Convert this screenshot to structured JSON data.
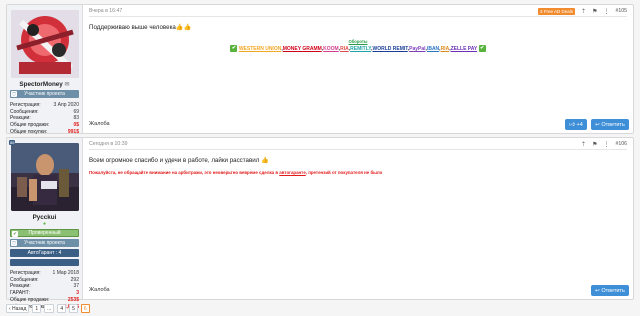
{
  "post1": {
    "avatar_alt": "",
    "username": "SpectorMoney",
    "badge": "Участник проекта",
    "stats": [
      {
        "label": "Регистрация:",
        "value": "3 Апр 2020",
        "red": false
      },
      {
        "label": "Сообщения:",
        "value": "69",
        "red": false
      },
      {
        "label": "Реакции:",
        "value": "83",
        "red": false
      },
      {
        "label": "Общие продажи:",
        "value": "0$",
        "red": true
      },
      {
        "label": "Общие покупки:",
        "value": "991$",
        "red": true
      }
    ],
    "date": "Вчера в 16:47",
    "tag": "3 Free AD Deals",
    "number": "#105",
    "message": "Поддерживаю выше человека",
    "sig_title": "Обороты",
    "sig_items": [
      {
        "text": "WESTERN UNION",
        "cls": "s-wu"
      },
      {
        "text": ",",
        "cls": ""
      },
      {
        "text": "MONEY GRAMM",
        "cls": "s-mg"
      },
      {
        "text": ",",
        "cls": ""
      },
      {
        "text": "KOOM",
        "cls": "s-ko"
      },
      {
        "text": ",",
        "cls": ""
      },
      {
        "text": "RIA",
        "cls": "s-ra"
      },
      {
        "text": ",",
        "cls": ""
      },
      {
        "text": "REMITLY",
        "cls": "s-rem"
      },
      {
        "text": ",",
        "cls": ""
      },
      {
        "text": "WORLD REMIT",
        "cls": "s-wr"
      },
      {
        "text": ",",
        "cls": ""
      },
      {
        "text": "PayPal",
        "cls": "s-pp"
      },
      {
        "text": ",",
        "cls": ""
      },
      {
        "text": "IBAN",
        "cls": "s-iban"
      },
      {
        "text": ",",
        "cls": ""
      },
      {
        "text": "RIA",
        "cls": "s-ria"
      },
      {
        "text": ",",
        "cls": ""
      },
      {
        "text": "ZELLE PAY",
        "cls": "s-zelle"
      }
    ],
    "complaint": "Жалоба",
    "like_count": "4",
    "reply": "Ответить"
  },
  "post2": {
    "rank": "86",
    "username": "Pycckui",
    "badges": [
      "Проверенный",
      "Участник проекта",
      "АвтоГарант : 4"
    ],
    "stats": [
      {
        "label": "Регистрация:",
        "value": "1 Мар 2018",
        "red": false
      },
      {
        "label": "Сообщения:",
        "value": "292",
        "red": false
      },
      {
        "label": "Реакции:",
        "value": "37",
        "red": false
      },
      {
        "label": "ГАРАНТ:",
        "value": "3",
        "red": true
      },
      {
        "label": "Общие продажи:",
        "value": "253$",
        "red": true
      },
      {
        "label": "Общие покупки:",
        "value": "2,606$",
        "red": true
      }
    ],
    "date": "Сегодня в 10:39",
    "number": "#106",
    "message": "Всем огромное спасибо и удечи в работе, лайки расставил",
    "warn_pre": "Пожалуйста, не обращайте внимание на арбитражи, это неоверьтно вевреме сделка в ",
    "warn_link": "автогаранте",
    "warn_post": ", претензий от покупателя не было",
    "complaint": "Жалоба",
    "reply": "Ответить"
  },
  "pager": {
    "prev": "‹ Назад",
    "pages": [
      "1",
      "...",
      "4",
      "5",
      "6"
    ],
    "active": "6"
  }
}
